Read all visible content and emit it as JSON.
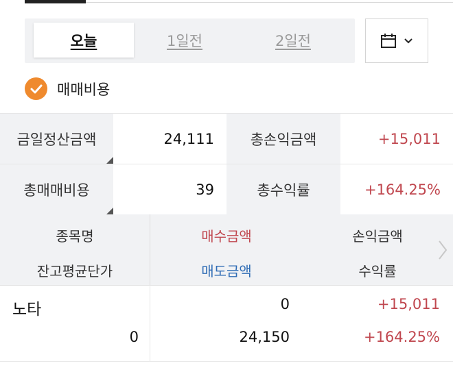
{
  "day_tabs": [
    {
      "label": "오늘",
      "selected": true
    },
    {
      "label": "1일전",
      "selected": false
    },
    {
      "label": "2일전",
      "selected": false
    }
  ],
  "calendar": {
    "icon": "calendar-icon",
    "dropdown_icon": "chevron-down-icon"
  },
  "fee_option": {
    "label": "매매비용",
    "checked": true
  },
  "summary": {
    "settlement_label": "금일정산금액",
    "settlement_value": "24,111",
    "total_pl_label": "총손익금액",
    "total_pl_value": "+15,011",
    "total_fee_label": "총매매비용",
    "total_fee_value": "39",
    "total_return_label": "총수익률",
    "total_return_value": "+164.25%"
  },
  "columns": {
    "name": "종목명",
    "buy_amount": "매수금액",
    "pl_amount": "손익금액",
    "avg_price": "잔고평균단가",
    "sell_amount": "매도금액",
    "return_rate": "수익률"
  },
  "rows": [
    {
      "name": "노타",
      "buy_amount": "0",
      "pl_amount": "+15,011",
      "avg_price": "0",
      "sell_amount": "24,150",
      "return_rate": "+164.25%"
    }
  ],
  "colors": {
    "accent": "#ef8a2e",
    "profit": "#c0474f",
    "sell": "#2f6cb5"
  }
}
